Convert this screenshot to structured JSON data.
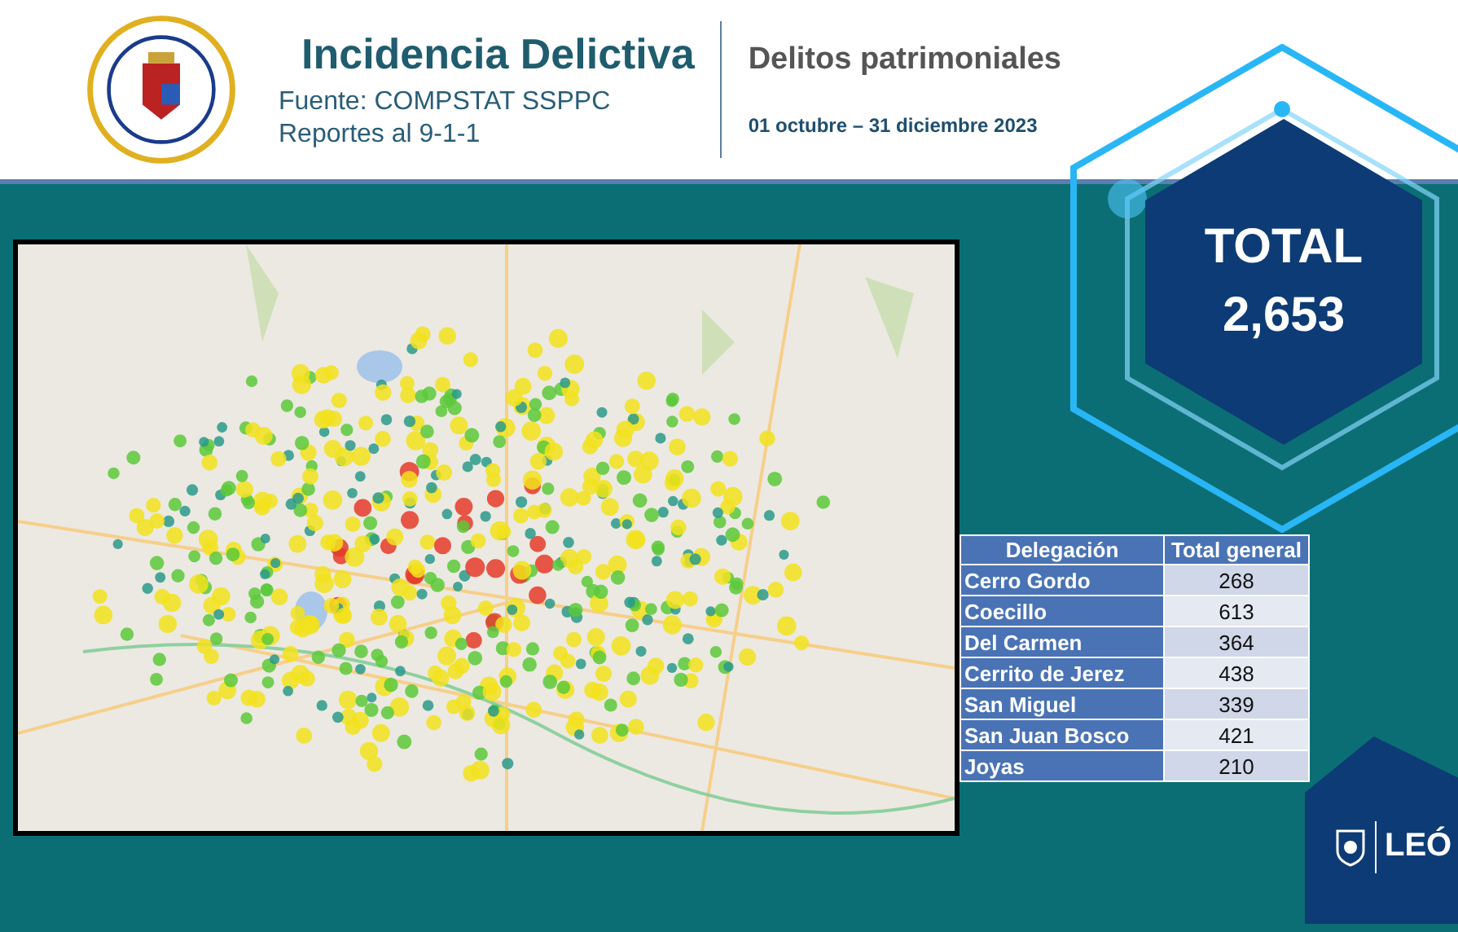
{
  "header": {
    "title": "Incidencia Delictiva",
    "source": "Fuente: COMPSTAT SSPPC",
    "reports": "Reportes al 9-1-1",
    "subtitle": "Delitos patrimoniales",
    "period": "01 octubre – 31 diciembre 2023"
  },
  "total": {
    "label": "TOTAL",
    "value": "2,653"
  },
  "table": {
    "columns": [
      "Delegación",
      "Total general"
    ],
    "rows": [
      [
        "Cerro Gordo",
        "268"
      ],
      [
        "Coecillo",
        "613"
      ],
      [
        "Del Carmen",
        "364"
      ],
      [
        "Cerrito de Jerez",
        "438"
      ],
      [
        "San Miguel",
        "339"
      ],
      [
        "San Juan Bosco",
        "421"
      ],
      [
        "Joyas",
        "210"
      ]
    ]
  },
  "logo": {
    "text": "LEÓ"
  }
}
